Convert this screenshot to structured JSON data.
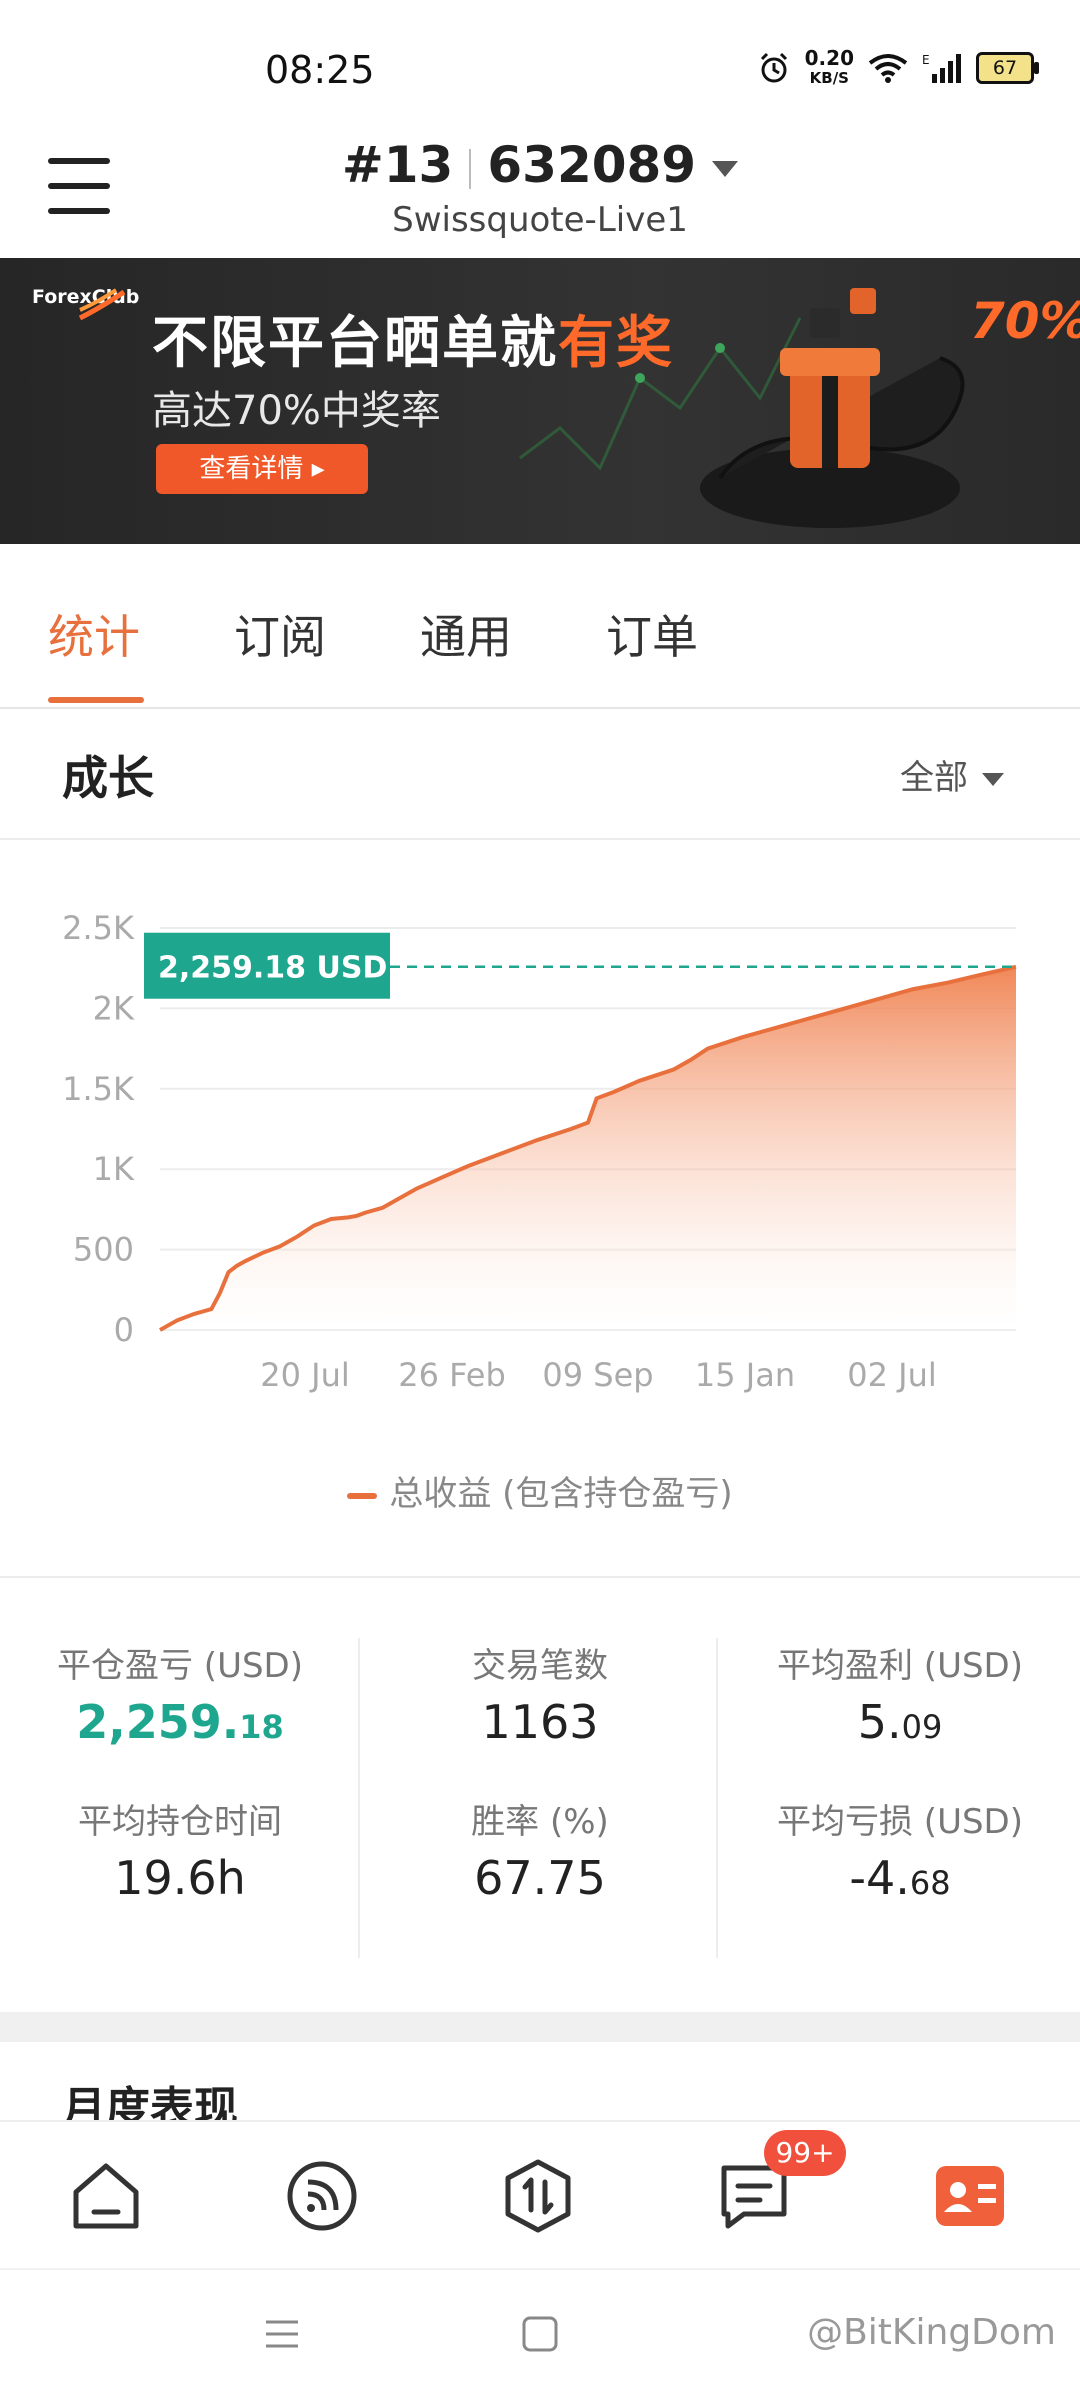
{
  "status_bar": {
    "time": "08:25",
    "net_speed_value": "0.20",
    "net_speed_unit": "KB/S",
    "battery": "67"
  },
  "header": {
    "account_number": "#13",
    "account_id": "632089",
    "server": "Swissquote-Live1"
  },
  "banner": {
    "logo": "ForexClub",
    "title_prefix": "不限平台晒单就",
    "title_highlight": "有奖",
    "subtitle": "高达70%中奖率",
    "button": "查看详情 ▸",
    "badge_text": "70%"
  },
  "tabs": [
    {
      "label": "统计",
      "active": true
    },
    {
      "label": "订阅",
      "active": false
    },
    {
      "label": "通用",
      "active": false
    },
    {
      "label": "订单",
      "active": false
    }
  ],
  "growth": {
    "title": "成长",
    "filter": "全部"
  },
  "chart_data": {
    "type": "area",
    "ylim": [
      0,
      2500
    ],
    "y_ticks": [
      "0",
      "500",
      "1K",
      "1.5K",
      "2K",
      "2.5K"
    ],
    "x_ticks": [
      "20 Jul",
      "26 Feb",
      "09 Sep",
      "15 Jan",
      "02 Jul"
    ],
    "current_value_label": "2,259.18 USD",
    "current_value": 2259.18,
    "series": [
      {
        "name": "总收益 (包含持仓盈亏)",
        "color": "#e8703d",
        "x": [
          0,
          0.02,
          0.04,
          0.05,
          0.06,
          0.07,
          0.08,
          0.09,
          0.1,
          0.12,
          0.14,
          0.16,
          0.18,
          0.2,
          0.22,
          0.23,
          0.24,
          0.26,
          0.28,
          0.3,
          0.33,
          0.36,
          0.4,
          0.44,
          0.48,
          0.5,
          0.51,
          0.53,
          0.56,
          0.6,
          0.62,
          0.64,
          0.68,
          0.72,
          0.76,
          0.8,
          0.84,
          0.88,
          0.92,
          0.96,
          1.0
        ],
        "values": [
          0,
          60,
          100,
          115,
          130,
          230,
          360,
          400,
          430,
          480,
          520,
          580,
          650,
          690,
          700,
          710,
          730,
          760,
          820,
          880,
          950,
          1020,
          1100,
          1180,
          1250,
          1290,
          1440,
          1480,
          1550,
          1620,
          1680,
          1750,
          1820,
          1880,
          1940,
          2000,
          2060,
          2120,
          2160,
          2210,
          2259
        ]
      }
    ]
  },
  "legend_label": "总收益 (包含持仓盈亏)",
  "stats": [
    {
      "label": "平仓盈亏 (USD)",
      "value_main": "2,259.",
      "value_small": "18",
      "green": true
    },
    {
      "label": "交易笔数",
      "value_main": "1163",
      "value_small": "",
      "green": false
    },
    {
      "label": "平均盈利 (USD)",
      "value_main": "5.",
      "value_small": "09",
      "green": false
    },
    {
      "label": "平均持仓时间",
      "value_main": "19.6h",
      "value_small": "",
      "green": false
    },
    {
      "label": "胜率 (%)",
      "value_main": "67.75",
      "value_small": "",
      "green": false
    },
    {
      "label": "平均亏损 (USD)",
      "value_main": "-4.",
      "value_small": "68",
      "green": false
    }
  ],
  "monthly": {
    "title": "月度表现"
  },
  "bottom_nav": {
    "badge": "99+",
    "items": [
      "home-icon",
      "feed-icon",
      "trade-icon",
      "message-icon",
      "profile-card-icon"
    ]
  },
  "watermark": "@BitKingDom"
}
